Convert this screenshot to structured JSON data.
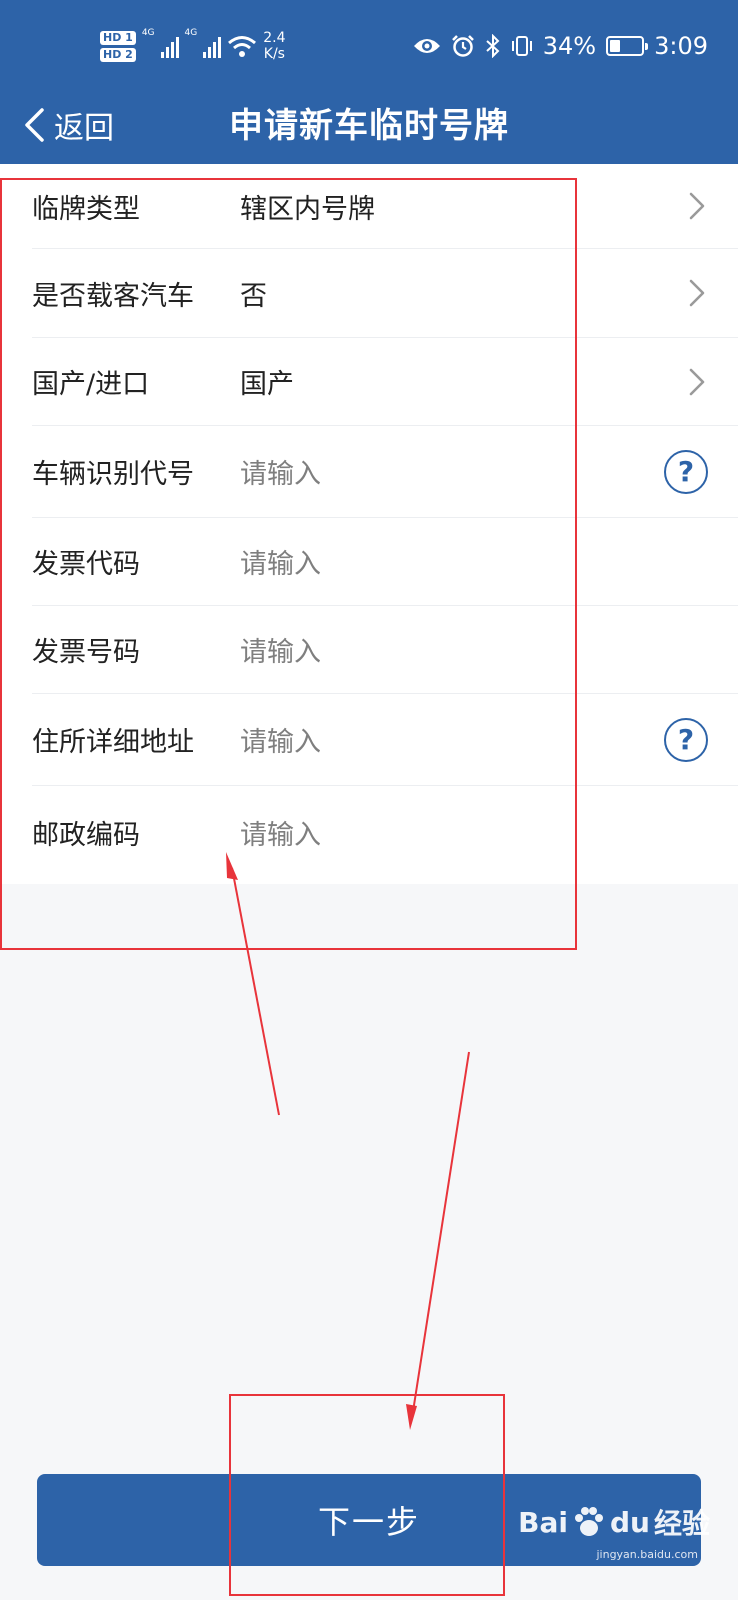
{
  "status_bar": {
    "sim1": "HD 1",
    "sim2": "HD 2",
    "net1": "4G",
    "net2": "4G",
    "speed_value": "2.4",
    "speed_unit": "K/s",
    "battery": "34%",
    "battery_level": 0.34,
    "time": "3:09"
  },
  "nav": {
    "back_label": "返回",
    "title": "申请新车临时号牌"
  },
  "form": {
    "rows": [
      {
        "label": "临牌类型",
        "value": "辖区内号牌",
        "accessory": "chevron-right-icon"
      },
      {
        "label": "是否载客汽车",
        "value": "否",
        "accessory": "chevron-right-icon"
      },
      {
        "label": "国产/进口",
        "value": "国产",
        "accessory": "chevron-right-icon"
      },
      {
        "label": "车辆识别代号",
        "placeholder": "请输入",
        "accessory": "help-icon"
      },
      {
        "label": "发票代码",
        "placeholder": "请输入"
      },
      {
        "label": "发票号码",
        "placeholder": "请输入"
      },
      {
        "label": "住所详细地址",
        "placeholder": "请输入",
        "accessory": "help-icon"
      },
      {
        "label": "邮政编码",
        "placeholder": "请输入"
      }
    ]
  },
  "actions": {
    "next_label": "下一步"
  },
  "watermark": {
    "brand": "Bai",
    "brand2": "du",
    "product": "经验",
    "sub": "jingyan.baidu.com"
  },
  "colors": {
    "primary": "#2d63a8",
    "annotation": "#e8343b",
    "placeholder": "#7f7f7f"
  }
}
